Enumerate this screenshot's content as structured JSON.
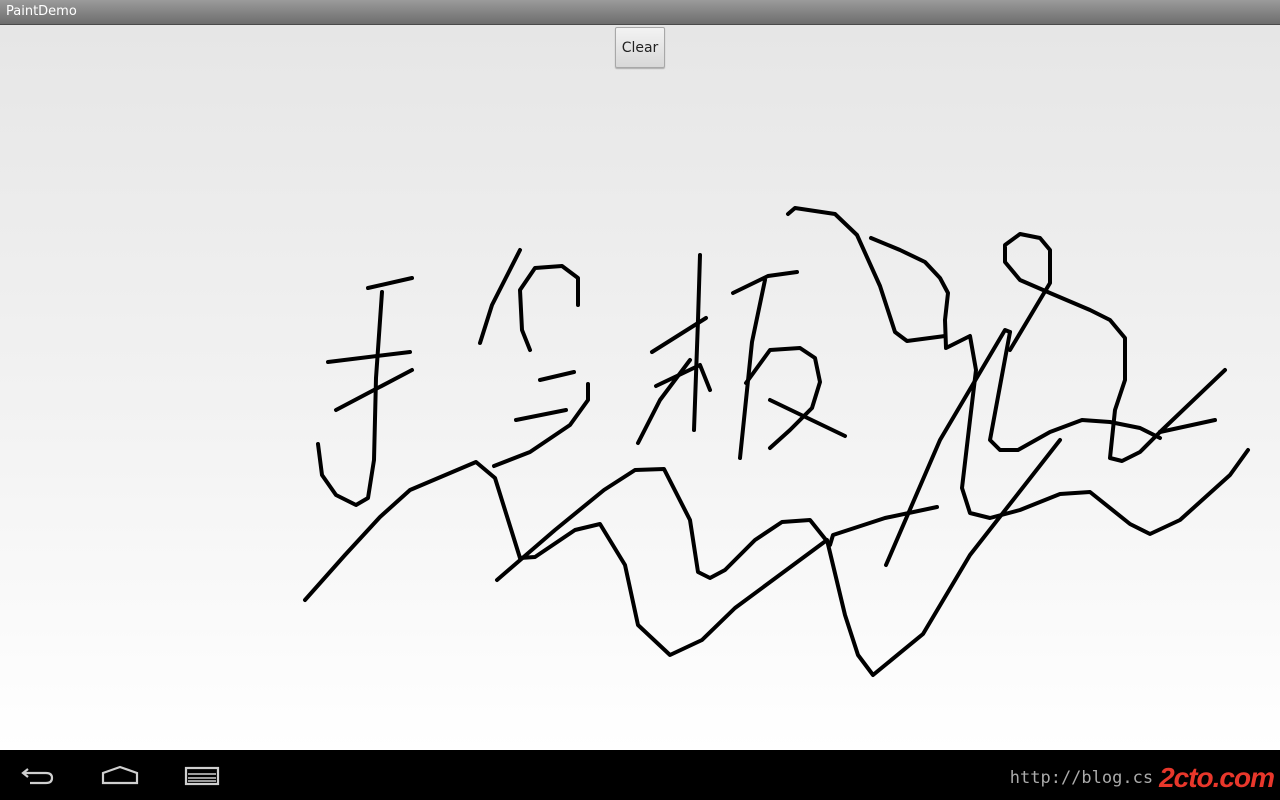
{
  "window": {
    "title": "PaintDemo"
  },
  "toolbar": {
    "clear_label": "Clear"
  },
  "canvas": {
    "stroke_color": "#000000",
    "strokes": [
      "M368,288 L412,278",
      "M328,362 L410,352",
      "M336,410 L412,370",
      "M382,292 L376,378 L374,460 L368,498 L356,505 L336,495 L322,475 L318,444",
      "M480,343 L492,305 L520,250",
      "M530,350 L522,330 L520,290 L535,268 L562,266 L578,278 L578,305",
      "M540,380 L574,372",
      "M516,420 L566,410",
      "M588,384 L588,400 L570,425 L530,452 L494,466",
      "M700,255 L698,320 L694,430",
      "M652,352 L706,318",
      "M638,443 L660,400 L690,360",
      "M656,386 L700,365 L710,390",
      "M733,293 L768,276 L797,272",
      "M765,280 L752,342 L740,458",
      "M746,383 L770,350 L800,348 L815,358 L820,382 L812,408 L790,430 L770,448",
      "M770,400 L845,436",
      "M788,214 L795,208 L835,214 L857,235 L880,286 L895,332 L907,341 L945,336",
      "M871,238 L900,250 L925,262 L940,278 L948,293 L945,320 L946,348 L970,336 L976,370 L970,420 L962,488 L970,513 L990,518 L1020,510 L1060,494 L1090,492 L1130,524 L1150,534 L1180,520 L1230,475 L1248,450",
      "M1010,350 L1050,283 L1050,250 L1040,238 L1020,234 L1005,245 L1005,262 L1020,280 L1050,293 L1090,310 L1110,320 L1125,338 L1125,380 L1115,410 L1110,458 L1122,461 L1140,452 L1160,432",
      "M1160,432 L1225,370",
      "M1160,432 L1215,420",
      "M1010,332 L990,440 L1000,450 L1018,450 L1050,432 L1082,420 L1110,422 L1140,428 L1160,438",
      "M1010,332 L1005,330 L940,440 L886,565",
      "M305,600 L345,555 L380,517 L410,490 L476,462 L495,478 L520,558 L535,557 L575,530 L600,524 L625,565 L638,625 L670,655 L702,640 L735,608 L827,540 L845,615 L858,655 L873,675 L923,634 L970,555 L1060,440",
      "M497,580 L555,530 L604,490 L635,470 L664,469 L690,520 L698,572 L710,578 L725,570 L755,540 L782,522 L810,520 L830,545 L833,535 L885,518 L937,507"
    ]
  },
  "navbar": {
    "back_icon": "back-arrow-icon",
    "home_icon": "home-icon",
    "recents_icon": "recent-apps-icon"
  },
  "watermark": {
    "url_text": "http://blog.cs",
    "logo_text": "2cto.com"
  }
}
